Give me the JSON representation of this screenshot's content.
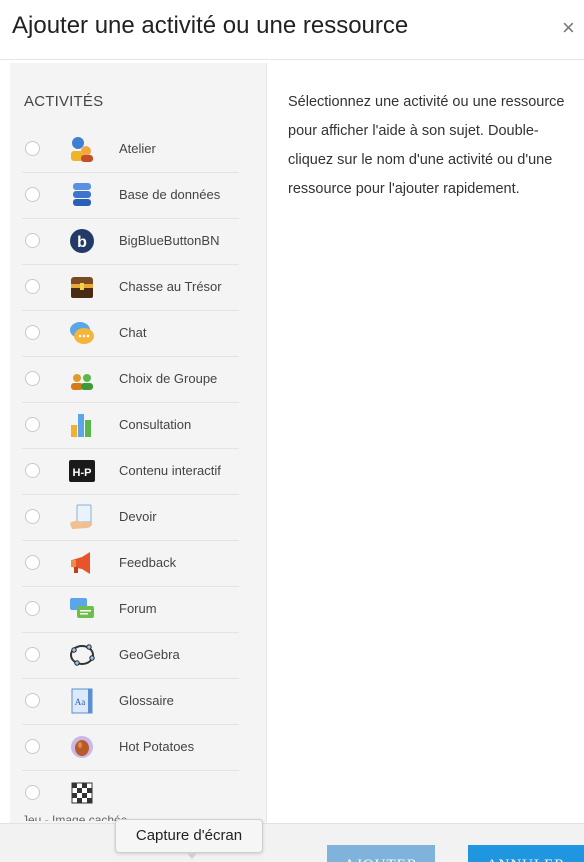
{
  "dialog": {
    "title": "Ajouter une activité ou une ressource",
    "close_symbol": "×"
  },
  "activities": {
    "heading": "ACTIVITÉS",
    "items": [
      {
        "label": "Atelier",
        "icon": "workshop-icon"
      },
      {
        "label": "Base de données",
        "icon": "database-icon"
      },
      {
        "label": "BigBlueButtonBN",
        "icon": "bigbluebutton-icon"
      },
      {
        "label": "Chasse au Trésor",
        "icon": "treasure-chest-icon"
      },
      {
        "label": "Chat",
        "icon": "chat-bubble-icon"
      },
      {
        "label": "Choix de Groupe",
        "icon": "group-choice-icon"
      },
      {
        "label": "Consultation",
        "icon": "bar-chart-icon"
      },
      {
        "label": "Contenu interactif",
        "icon": "h5p-icon"
      },
      {
        "label": "Devoir",
        "icon": "assignment-hand-icon"
      },
      {
        "label": "Feedback",
        "icon": "megaphone-icon"
      },
      {
        "label": "Forum",
        "icon": "forum-icon"
      },
      {
        "label": "GeoGebra",
        "icon": "geogebra-icon"
      },
      {
        "label": "Glossaire",
        "icon": "glossary-icon"
      },
      {
        "label": "Hot Potatoes",
        "icon": "hot-potatoes-icon"
      },
      {
        "label": "",
        "icon": "checkerboard-icon"
      }
    ],
    "cut_off_label": "Jeu - Image cachée"
  },
  "help_text": "Sélectionnez une activité ou une ressource pour afficher l'aide à son sujet. Double-cliquez sur le nom d'une activité ou d'une ressource pour l'ajouter rapidement.",
  "footer": {
    "add_label": "AJOUTER",
    "cancel_label": "ANNULER"
  },
  "tooltip": {
    "text": "Capture d'écran"
  },
  "colors": {
    "add_button": "#7fb3dc",
    "cancel_button": "#2196e0",
    "list_background": "#f4f4f4"
  }
}
